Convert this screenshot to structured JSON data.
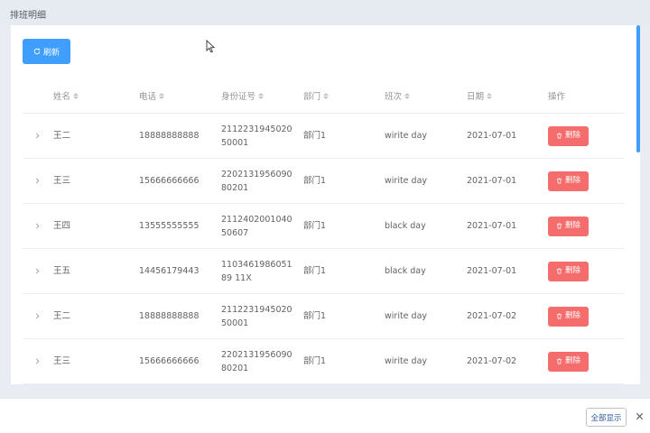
{
  "header": {
    "title": "排班明细"
  },
  "toolbar": {
    "refresh_label": "刷新",
    "refresh_icon": "refresh-icon"
  },
  "table": {
    "columns": [
      "姓名",
      "电话",
      "身份证号",
      "部门",
      "班次",
      "日期",
      "操作"
    ],
    "rows": [
      {
        "name": "王二",
        "phone": "18888888888",
        "id": "211223194502050001",
        "dept": "部门1",
        "shift": "wirite day",
        "date": "2021-07-01",
        "action": "删除"
      },
      {
        "name": "王三",
        "phone": "15666666666",
        "id": "220213195609080201",
        "dept": "部门1",
        "shift": "wirite day",
        "date": "2021-07-01",
        "action": "删除"
      },
      {
        "name": "王四",
        "phone": "13555555555",
        "id": "211240200104050607",
        "dept": "部门1",
        "shift": "black day",
        "date": "2021-07-01",
        "action": "删除"
      },
      {
        "name": "王五",
        "phone": "14456179443",
        "id": "110346198605189 11X",
        "dept": "部门1",
        "shift": "black day",
        "date": "2021-07-01",
        "action": "删除"
      },
      {
        "name": "王二",
        "phone": "18888888888",
        "id": "211223194502050001",
        "dept": "部门1",
        "shift": "wirite day",
        "date": "2021-07-02",
        "action": "删除"
      },
      {
        "name": "王三",
        "phone": "15666666666",
        "id": "220213195609080201",
        "dept": "部门1",
        "shift": "wirite day",
        "date": "2021-07-02",
        "action": "删除"
      }
    ]
  },
  "footer": {
    "show_all_label": "全部显示",
    "close_label": "✕"
  },
  "colors": {
    "primary": "#409eff",
    "danger": "#f56c6c"
  }
}
